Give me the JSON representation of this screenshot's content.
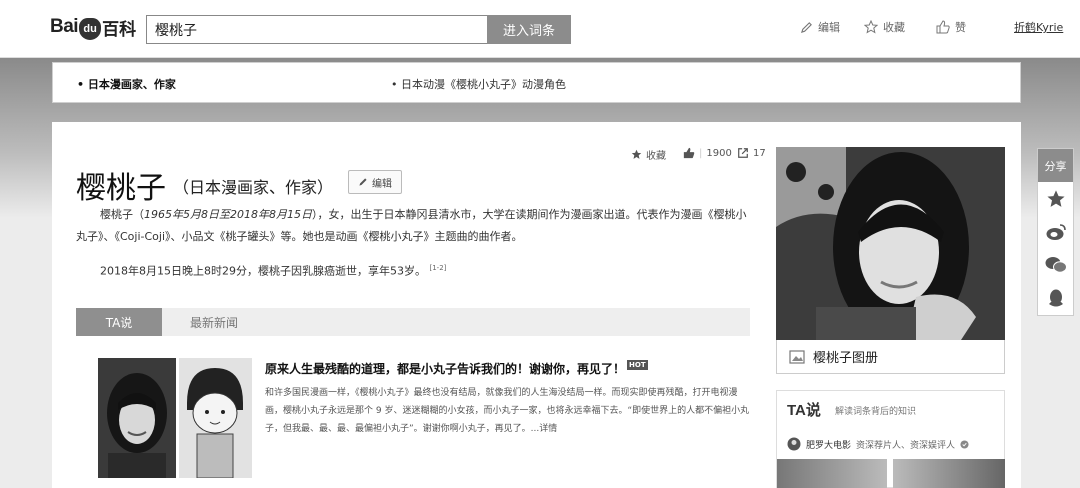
{
  "header": {
    "logo_left": "Bai",
    "logo_paw": "du",
    "logo_right": "百科",
    "search_value": "樱桃子",
    "search_button": "进入词条",
    "edit_label": "编辑",
    "favorite_label": "收藏",
    "like_label": "赞",
    "username": "折鹤Kyrie"
  },
  "disambiguation": {
    "items": [
      "日本漫画家、作家",
      "日本动漫《樱桃小丸子》动漫角色"
    ]
  },
  "entry": {
    "title": "樱桃子",
    "subtitle": "（日本漫画家、作家）",
    "edit_label": "编辑",
    "favorite_label": "收藏",
    "likes": "1900",
    "shares": "17",
    "intro_name": "樱桃子（",
    "intro_dates": "1965年5月8日至2018年8月15日",
    "intro_rest": "），女，出生于日本静冈县清水市，大学在读期间作为漫画家出道。代表作为漫画《樱桃小丸子》、《Coji-Coji》、小品文《桃子罐头》等。她也是动画《樱桃小丸子》主题曲的曲作者。",
    "death_note": "2018年8月15日晚上8时29分，樱桃子因乳腺癌逝世，享年53岁。",
    "citation": "[1-2]"
  },
  "tabs": [
    "TA说",
    "最新新闻"
  ],
  "news": {
    "title": "原来人生最残酷的道理，都是小丸子告诉我们的！谢谢你，再见了！",
    "badge": "HOT",
    "body": "和许多国民漫画一样，《樱桃小丸子》最终也没有结局，就像我们的人生海没结局一样。而现实即使再残酷，打开电视漫画，樱桃小丸子永远是那个 9 岁、迷迷糊糊的小女孩，而小丸子一家，也将永远幸福下去。“即使世界上的人都不偏袒小丸子，但我最、最、最、最偏袒小丸子”。谢谢你啊小丸子，再见了。...详情"
  },
  "sidebar": {
    "album_label": "樱桃子图册",
    "ta_logo": "TA说",
    "ta_desc": "解读词条背后的知识",
    "ta_author": "肥罗大电影",
    "ta_author_desc": "资深荐片人、资深娱评人"
  },
  "share": {
    "label": "分享"
  }
}
